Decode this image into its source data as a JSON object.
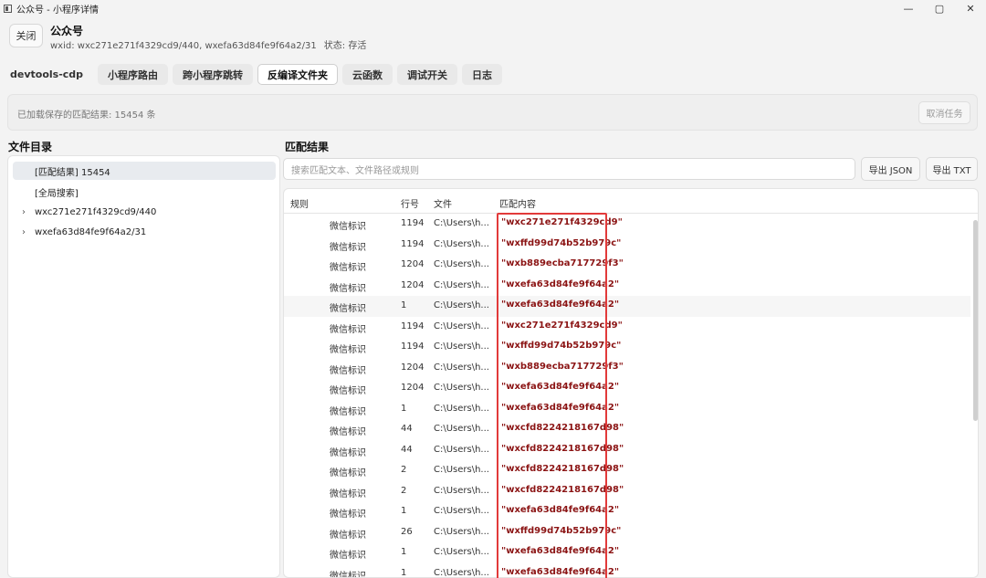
{
  "window": {
    "title": "公众号 - 小程序详情",
    "controls": [
      "—",
      "▢",
      "✕"
    ]
  },
  "header": {
    "close_label": "关闭",
    "account_name": "公众号",
    "wxid_text": "wxid: wxc271e271f4329cd9/440, wxefa63d84fe9f64a2/31",
    "status_text": "状态: 存活"
  },
  "tabs": [
    {
      "label": "devtools-cdp",
      "active": false
    },
    {
      "label": "小程序路由",
      "active": false
    },
    {
      "label": "跨小程序跳转",
      "active": false
    },
    {
      "label": "反编译文件夹",
      "active": true
    },
    {
      "label": "云函数",
      "active": false
    },
    {
      "label": "调试开关",
      "active": false
    },
    {
      "label": "日志",
      "active": false
    }
  ],
  "banner": {
    "text": "已加载保存的匹配结果: 15454 条",
    "cancel_label": "取消任务"
  },
  "left_panel": {
    "title": "文件目录",
    "items": [
      {
        "label": "[匹配结果] 15454",
        "chevron": false,
        "selected": true
      },
      {
        "label": "[全局搜索]",
        "chevron": false,
        "selected": false
      },
      {
        "label": "wxc271e271f4329cd9/440",
        "chevron": true,
        "selected": false
      },
      {
        "label": "wxefa63d84fe9f64a2/31",
        "chevron": true,
        "selected": false
      }
    ]
  },
  "right_panel": {
    "title": "匹配结果",
    "search_placeholder": "搜索匹配文本、文件路径或规则",
    "export_json_label": "导出 JSON",
    "export_txt_label": "导出 TXT",
    "columns": [
      "规则",
      "行号",
      "文件",
      "匹配内容"
    ],
    "rows": [
      {
        "rule": "微信标识",
        "line": "1194",
        "file": "C:\\Users\\h...",
        "match": "\"wxc271e271f4329cd9\""
      },
      {
        "rule": "微信标识",
        "line": "1194",
        "file": "C:\\Users\\h...",
        "match": "\"wxffd99d74b52b979c\""
      },
      {
        "rule": "微信标识",
        "line": "1204",
        "file": "C:\\Users\\h...",
        "match": "\"wxb889ecba717729f3\""
      },
      {
        "rule": "微信标识",
        "line": "1204",
        "file": "C:\\Users\\h...",
        "match": "\"wxefa63d84fe9f64a2\""
      },
      {
        "rule": "微信标识",
        "line": "1",
        "file": "C:\\Users\\h...",
        "match": "\"wxefa63d84fe9f64a2\""
      },
      {
        "rule": "微信标识",
        "line": "1194",
        "file": "C:\\Users\\h...",
        "match": "\"wxc271e271f4329cd9\""
      },
      {
        "rule": "微信标识",
        "line": "1194",
        "file": "C:\\Users\\h...",
        "match": "\"wxffd99d74b52b979c\""
      },
      {
        "rule": "微信标识",
        "line": "1204",
        "file": "C:\\Users\\h...",
        "match": "\"wxb889ecba717729f3\""
      },
      {
        "rule": "微信标识",
        "line": "1204",
        "file": "C:\\Users\\h...",
        "match": "\"wxefa63d84fe9f64a2\""
      },
      {
        "rule": "微信标识",
        "line": "1",
        "file": "C:\\Users\\h...",
        "match": "\"wxefa63d84fe9f64a2\""
      },
      {
        "rule": "微信标识",
        "line": "44",
        "file": "C:\\Users\\h...",
        "match": "\"wxcfd8224218167d98\""
      },
      {
        "rule": "微信标识",
        "line": "44",
        "file": "C:\\Users\\h...",
        "match": "\"wxcfd8224218167d98\""
      },
      {
        "rule": "微信标识",
        "line": "2",
        "file": "C:\\Users\\h...",
        "match": "\"wxcfd8224218167d98\""
      },
      {
        "rule": "微信标识",
        "line": "2",
        "file": "C:\\Users\\h...",
        "match": "\"wxcfd8224218167d98\""
      },
      {
        "rule": "微信标识",
        "line": "1",
        "file": "C:\\Users\\h...",
        "match": "\"wxefa63d84fe9f64a2\""
      },
      {
        "rule": "微信标识",
        "line": "26",
        "file": "C:\\Users\\h...",
        "match": "\"wxffd99d74b52b979c\""
      },
      {
        "rule": "微信标识",
        "line": "1",
        "file": "C:\\Users\\h...",
        "match": "\"wxefa63d84fe9f64a2\""
      },
      {
        "rule": "微信标识",
        "line": "1",
        "file": "C:\\Users\\h...",
        "match": "\"wxefa63d84fe9f64a2\""
      }
    ]
  },
  "colors": {
    "match_text": "#8b1414",
    "highlight_border": "#e23a3a"
  }
}
